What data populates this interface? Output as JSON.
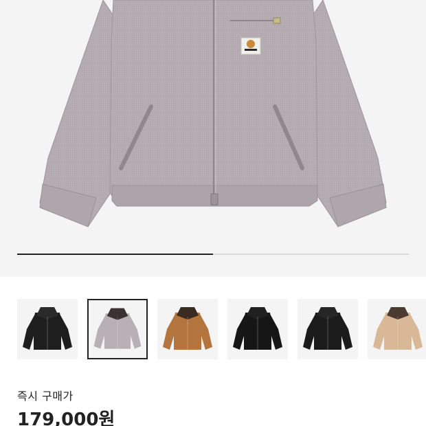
{
  "product": {
    "image_icon": "jacket-image",
    "label_icon": "carhartt-label-icon"
  },
  "gallery": {
    "progress_fraction": 0.5
  },
  "thumbnails": [
    {
      "body_color": "#1e1e1e",
      "collar_color": "#2a2a2a",
      "selected": false,
      "icon": "black-jacket-thumbnail"
    },
    {
      "body_color": "#b8b0b4",
      "collar_color": "#3b3332",
      "selected": true,
      "icon": "grey-jacket-thumbnail"
    },
    {
      "body_color": "#b3743e",
      "collar_color": "#3a2b22",
      "selected": false,
      "icon": "brown-jacket-thumbnail"
    },
    {
      "body_color": "#161616",
      "collar_color": "#202020",
      "selected": false,
      "icon": "leather-jacket-thumbnail"
    },
    {
      "body_color": "#1b1b1b",
      "collar_color": "#262626",
      "selected": false,
      "icon": "black-jacket-thumbnail"
    },
    {
      "body_color": "#d8b896",
      "collar_color": "#4a3a30",
      "selected": false,
      "icon": "beige-jacket-thumbnail"
    }
  ],
  "price": {
    "label": "즉시 구매가",
    "value": "179,000원"
  }
}
